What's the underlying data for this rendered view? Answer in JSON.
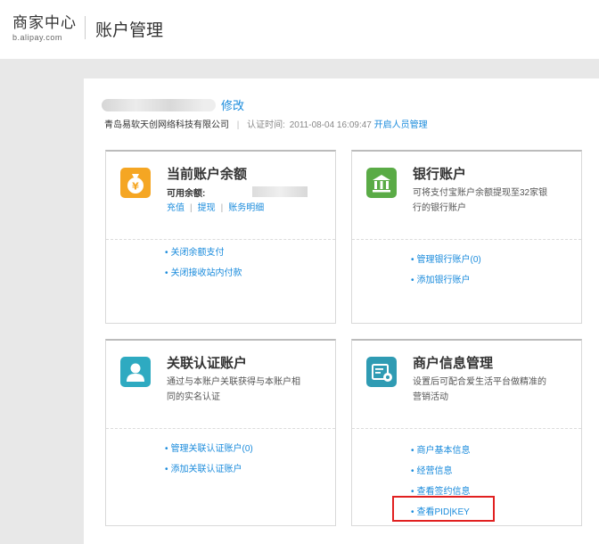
{
  "header": {
    "brand_cn": "商家中心",
    "brand_en": "b.alipay.com",
    "page_title": "账户管理"
  },
  "account": {
    "modify_label": "修改",
    "company_name": "青岛易软天创网络科技有限公司",
    "cert_label": "认证时间:",
    "cert_time": "2011-08-04 16:09:47",
    "staff_link": "开启人员管理"
  },
  "cards": {
    "balance": {
      "title": "当前账户余额",
      "available_label": "可用余额:",
      "actions": [
        "充值",
        "提现",
        "账务明细"
      ],
      "links": [
        "关闭余额支付",
        "关闭接收站内付款"
      ]
    },
    "bank": {
      "title": "银行账户",
      "desc_line1": "可将支付宝账户余额提现至32家银",
      "desc_line2": "行的银行账户",
      "links": [
        "管理银行账户(0)",
        "添加银行账户"
      ]
    },
    "linked": {
      "title": "关联认证账户",
      "desc_line1": "通过与本账户关联获得与本账户相",
      "desc_line2": "同的实名认证",
      "links": [
        "管理关联认证账户(0)",
        "添加关联认证账户"
      ]
    },
    "merchant": {
      "title": "商户信息管理",
      "desc_line1": "设置后可配合爱生活平台做精准的",
      "desc_line2": "营销活动",
      "links": [
        "商户基本信息",
        "经营信息",
        "查看签约信息",
        "查看PID|KEY"
      ]
    }
  },
  "colors": {
    "link": "#1a8bdc",
    "balance_icon": "#f5a623",
    "bank_icon": "#5aab46",
    "linked_icon": "#2eaac1",
    "merchant_icon": "#2f9bb3",
    "highlight": "#e12020"
  },
  "icons": {
    "balance": "money-bag-icon",
    "bank": "bank-icon",
    "linked": "user-icon",
    "merchant": "settings-document-icon"
  }
}
